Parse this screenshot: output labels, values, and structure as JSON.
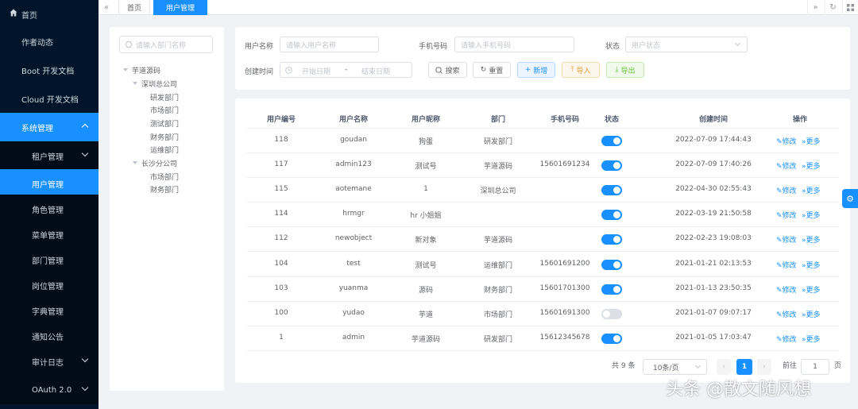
{
  "sidebar": {
    "items": [
      {
        "label": "首页"
      },
      {
        "label": "作者动态"
      },
      {
        "label": "Boot 开发文档"
      },
      {
        "label": "Cloud 开发文档"
      },
      {
        "label": "系统管理"
      },
      {
        "label": "租户管理"
      },
      {
        "label": "用户管理"
      },
      {
        "label": "角色管理"
      },
      {
        "label": "菜单管理"
      },
      {
        "label": "部门管理"
      },
      {
        "label": "岗位管理"
      },
      {
        "label": "字典管理"
      },
      {
        "label": "通知公告"
      },
      {
        "label": "审计日志"
      },
      {
        "label": "OAuth 2.0"
      }
    ]
  },
  "tabs": [
    {
      "label": "首页"
    },
    {
      "label": "用户管理"
    }
  ],
  "tree": {
    "search_placeholder": "请输入部门名称",
    "nodes": [
      {
        "label": "芋道源码"
      },
      {
        "label": "深圳总公司"
      },
      {
        "label": "研发部门"
      },
      {
        "label": "市场部门"
      },
      {
        "label": "测试部门"
      },
      {
        "label": "财务部门"
      },
      {
        "label": "运维部门"
      },
      {
        "label": "长沙分公司"
      },
      {
        "label": "市场部门"
      },
      {
        "label": "财务部门"
      }
    ]
  },
  "filter": {
    "username_label": "用户名称",
    "username_placeholder": "请输入用户名称",
    "phone_label": "手机号码",
    "phone_placeholder": "请输入手机号码",
    "status_label": "状态",
    "status_placeholder": "用户状态",
    "created_label": "创建时间",
    "start_placeholder": "开始日期",
    "range_sep": "-",
    "end_placeholder": "结束日期",
    "search_btn": "搜索",
    "reset_btn": "重置",
    "add_btn": "新增",
    "import_btn": "导入",
    "export_btn": "导出"
  },
  "table": {
    "headers": [
      "用户编号",
      "用户名称",
      "用户昵称",
      "部门",
      "手机号码",
      "状态",
      "创建时间",
      "操作"
    ],
    "edit_label": "修改",
    "more_label": "更多",
    "rows": [
      {
        "id": "118",
        "username": "goudan",
        "nickname": "狗蛋",
        "dept": "研发部门",
        "phone": "",
        "enabled": true,
        "created": "2022-07-09 17:44:43"
      },
      {
        "id": "117",
        "username": "admin123",
        "nickname": "测试号",
        "dept": "芋道源码",
        "phone": "15601691234",
        "enabled": true,
        "created": "2022-07-09 17:40:26"
      },
      {
        "id": "115",
        "username": "aotemane",
        "nickname": "1",
        "dept": "深圳总公司",
        "phone": "",
        "enabled": true,
        "created": "2022-04-30 02:55:43"
      },
      {
        "id": "114",
        "username": "hrmgr",
        "nickname": "hr 小姐姐",
        "dept": "",
        "phone": "",
        "enabled": true,
        "created": "2022-03-19 21:50:58"
      },
      {
        "id": "112",
        "username": "newobject",
        "nickname": "新对象",
        "dept": "芋道源码",
        "phone": "",
        "enabled": true,
        "created": "2022-02-23 19:08:03"
      },
      {
        "id": "104",
        "username": "test",
        "nickname": "测试号",
        "dept": "运维部门",
        "phone": "15601691200",
        "enabled": true,
        "created": "2021-01-21 02:13:53"
      },
      {
        "id": "103",
        "username": "yuanma",
        "nickname": "源码",
        "dept": "财务部门",
        "phone": "15601701300",
        "enabled": true,
        "created": "2021-01-13 23:50:35"
      },
      {
        "id": "100",
        "username": "yudao",
        "nickname": "芋道",
        "dept": "市场部门",
        "phone": "15601691300",
        "enabled": false,
        "created": "2021-01-07 09:07:17"
      },
      {
        "id": "1",
        "username": "admin",
        "nickname": "芋道源码",
        "dept": "研发部门",
        "phone": "15612345678",
        "enabled": true,
        "created": "2021-01-05 17:03:47"
      }
    ]
  },
  "pagination": {
    "total": "共 9 条",
    "page_size": "10条/页",
    "current_page": "1",
    "goto_label": "前往",
    "goto_value": "1",
    "page_unit": "页"
  },
  "watermark": "头条 @散文随风想",
  "colors": {
    "primary": "#1890ff",
    "sidebar": "#001529"
  }
}
